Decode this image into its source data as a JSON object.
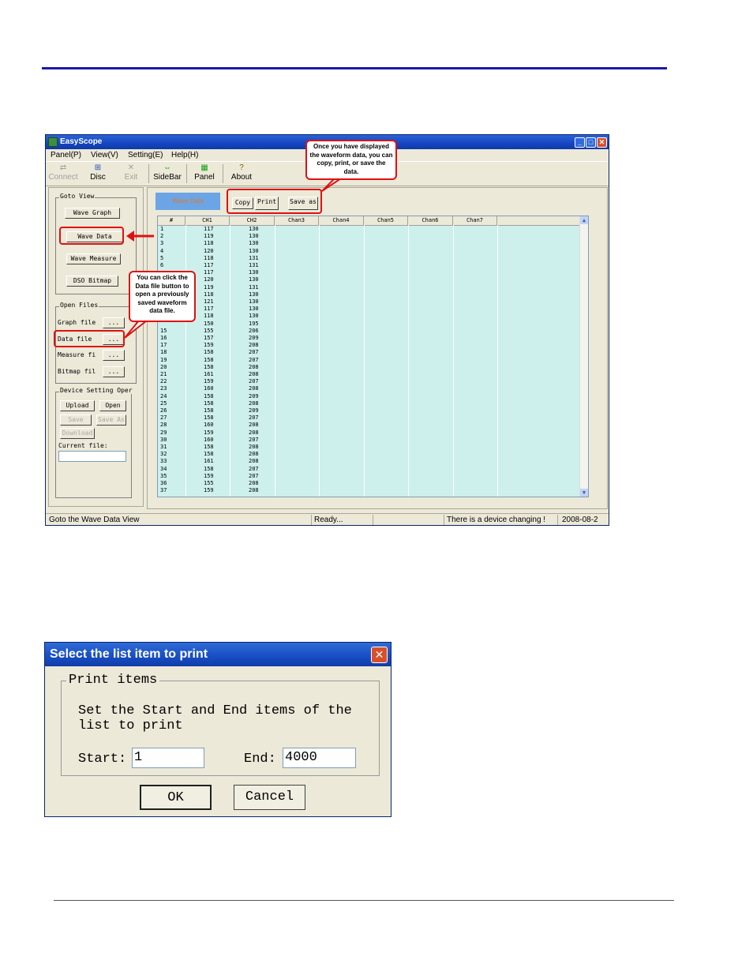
{
  "window": {
    "title": "EasyScope",
    "menu": [
      "Panel(P)",
      "View(V)",
      "Setting(E)",
      "Help(H)"
    ],
    "toolbar": {
      "connect": "Connect",
      "disc": "Disc",
      "exit": "Exit",
      "sidebar": "SideBar",
      "panel": "Panel",
      "about": "About"
    },
    "goto_view": {
      "label": "Goto View",
      "wave_graph": "Wave Graph",
      "wave_data": "Wave Data",
      "wave_measure": "Wave Measure",
      "dso_bitmap": "DSO Bitmap"
    },
    "open_files": {
      "label": "Open Files",
      "graph_file": "Graph file",
      "data_file": "Data file",
      "measure_file": "Measure fi",
      "bitmap_file": "Bitmap fil",
      "browse": "..."
    },
    "device_setting": {
      "label": "Device Setting Oper",
      "upload": "Upload",
      "open": "Open",
      "save": "Save",
      "save_as": "Save As",
      "download": "Download",
      "current_file": "Current file:"
    },
    "data_view": {
      "label": "Wave Data",
      "copy": "Copy",
      "print": "Print",
      "save_as": "Save as",
      "columns": [
        "#",
        "CH1",
        "CH2",
        "Chan3",
        "Chan4",
        "Chan5",
        "Chan6",
        "Chan7"
      ],
      "rows": [
        [
          "1",
          "117",
          "130"
        ],
        [
          "2",
          "119",
          "130"
        ],
        [
          "3",
          "118",
          "130"
        ],
        [
          "4",
          "120",
          "130"
        ],
        [
          "5",
          "118",
          "131"
        ],
        [
          "6",
          "117",
          "131"
        ],
        [
          "",
          "117",
          "130"
        ],
        [
          "",
          "120",
          "130"
        ],
        [
          "",
          "119",
          "131"
        ],
        [
          "",
          "118",
          "130"
        ],
        [
          "",
          "121",
          "130"
        ],
        [
          "",
          "117",
          "130"
        ],
        [
          "",
          "118",
          "130"
        ],
        [
          "",
          "150",
          "195"
        ],
        [
          "15",
          "155",
          "206"
        ],
        [
          "16",
          "157",
          "209"
        ],
        [
          "17",
          "159",
          "208"
        ],
        [
          "18",
          "158",
          "207"
        ],
        [
          "19",
          "158",
          "207"
        ],
        [
          "20",
          "158",
          "208"
        ],
        [
          "21",
          "161",
          "208"
        ],
        [
          "22",
          "159",
          "207"
        ],
        [
          "23",
          "160",
          "208"
        ],
        [
          "24",
          "158",
          "209"
        ],
        [
          "25",
          "158",
          "208"
        ],
        [
          "26",
          "158",
          "209"
        ],
        [
          "27",
          "158",
          "207"
        ],
        [
          "28",
          "160",
          "208"
        ],
        [
          "29",
          "159",
          "208"
        ],
        [
          "30",
          "160",
          "207"
        ],
        [
          "31",
          "158",
          "208"
        ],
        [
          "32",
          "158",
          "208"
        ],
        [
          "33",
          "161",
          "208"
        ],
        [
          "34",
          "158",
          "207"
        ],
        [
          "35",
          "159",
          "207"
        ],
        [
          "36",
          "155",
          "208"
        ],
        [
          "37",
          "159",
          "208"
        ]
      ]
    },
    "status": {
      "left": "Goto the Wave Data View",
      "middle": "Ready...",
      "right": "There is a device changing !",
      "date": "2008-08-2"
    },
    "callouts": {
      "copy_print": "Once you have displayed the waveform data, you can copy, print, or save the data.",
      "data_file": "You can click the Data file button to open a previously saved waveform data file."
    }
  },
  "dialog": {
    "title": "Select the list item to print",
    "group_label": "Print items",
    "instruction_line1": "Set the Start and End items of the",
    "instruction_line2": "list to print",
    "start_label": "Start:",
    "start_value": "1",
    "end_label": "End:",
    "end_value": "4000",
    "ok": "OK",
    "cancel": "Cancel"
  }
}
